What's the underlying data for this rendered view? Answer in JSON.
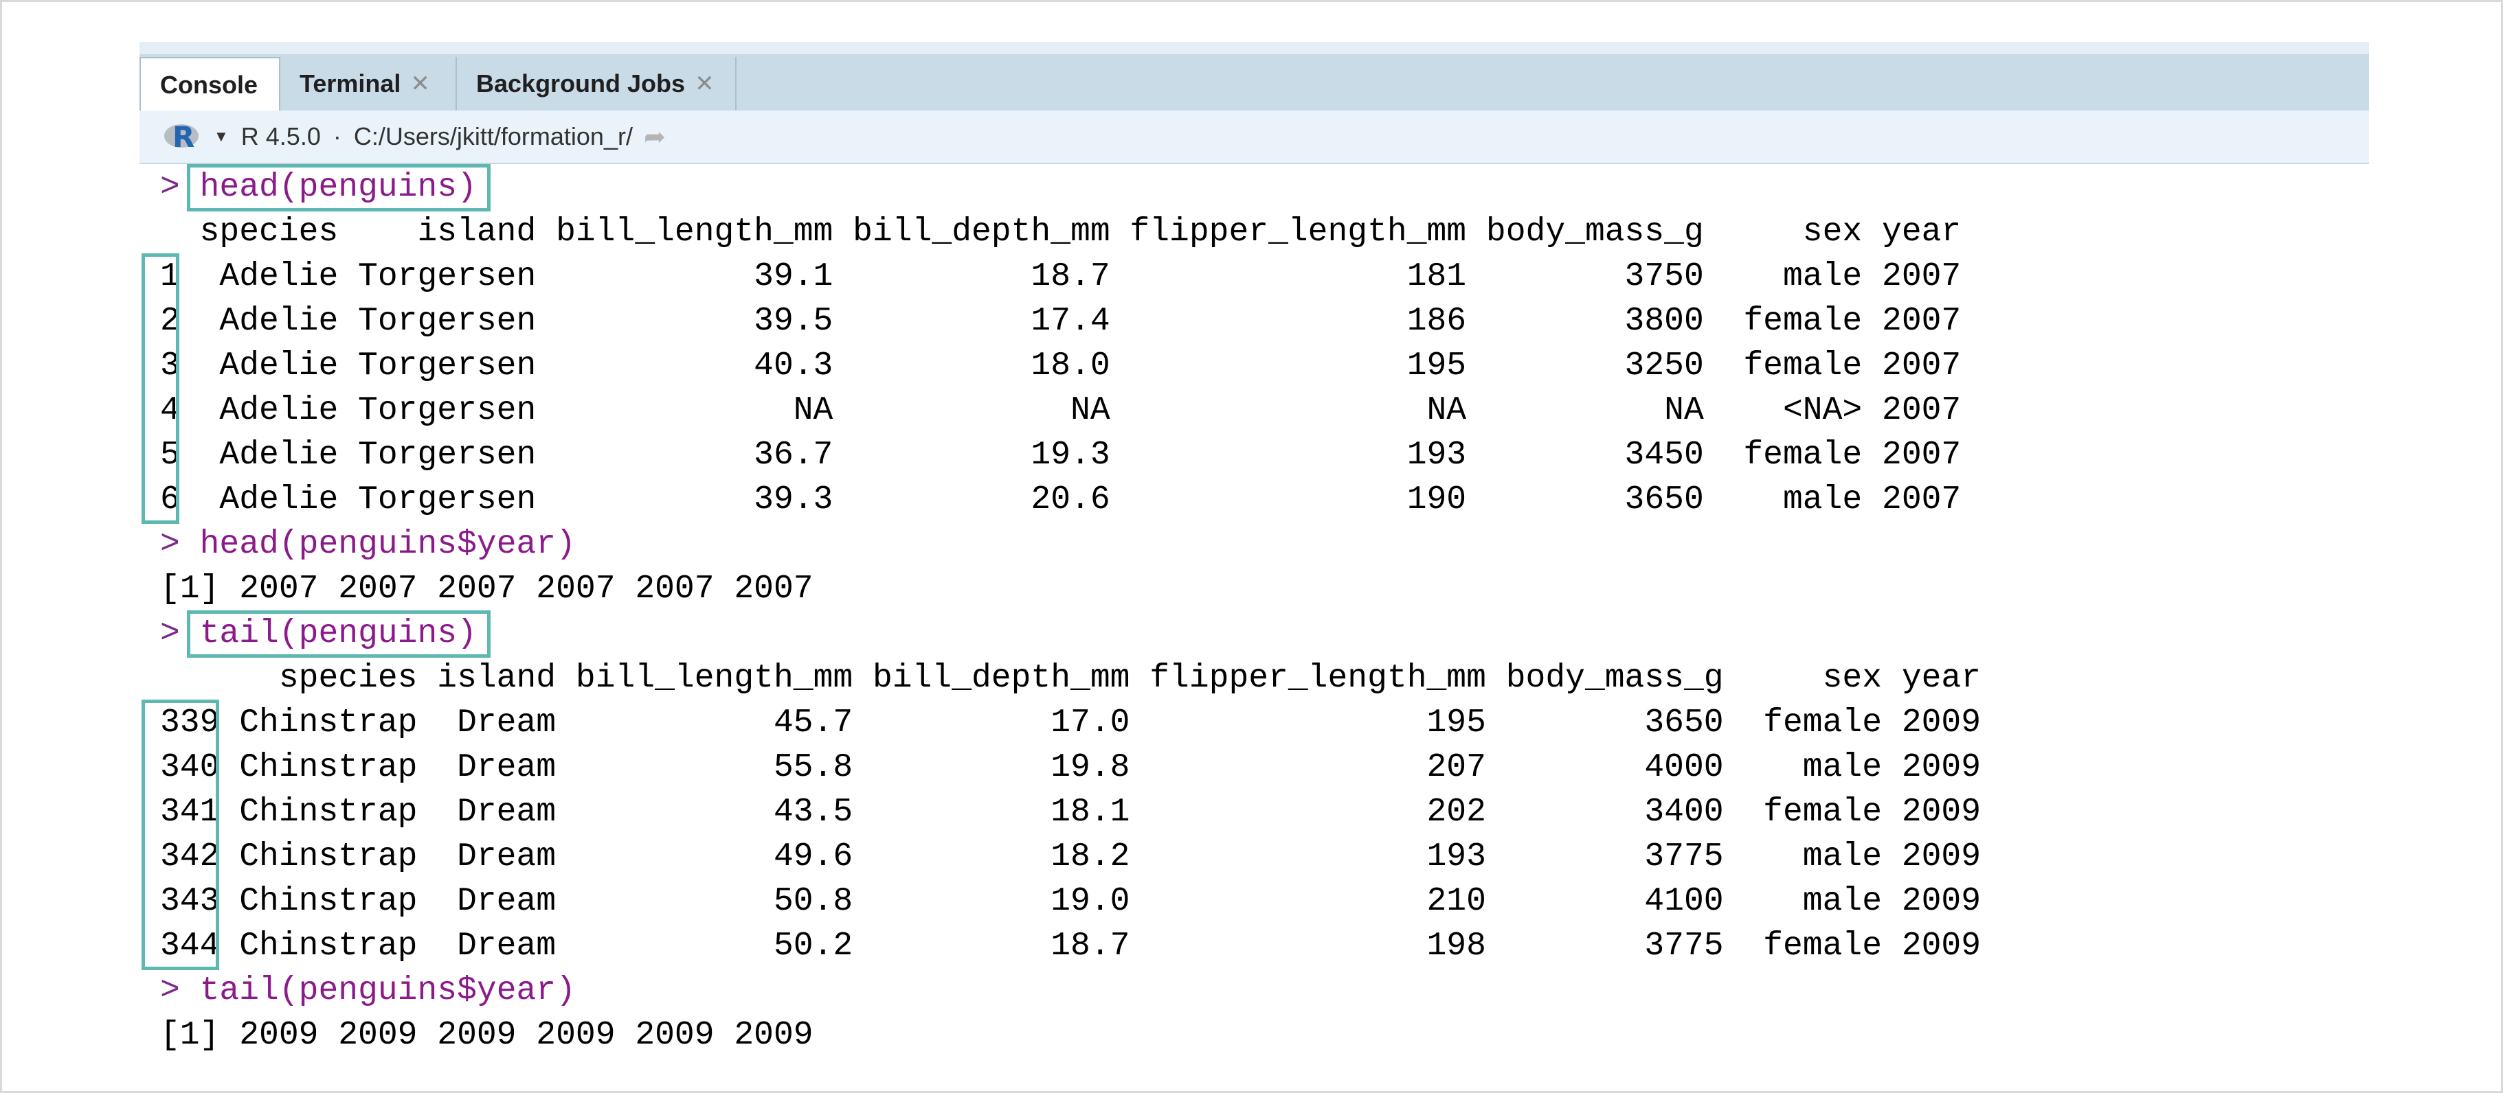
{
  "tabs": [
    {
      "label": "Console",
      "closable": false,
      "active": true
    },
    {
      "label": "Terminal",
      "closable": true,
      "active": false
    },
    {
      "label": "Background Jobs",
      "closable": true,
      "active": false
    }
  ],
  "toolbar": {
    "r_logo": "R",
    "version": "R 4.5.0",
    "separator": "·",
    "path": "C:/Users/jkitt/formation_r/",
    "nav_icon": "go-to-directory-icon"
  },
  "console": {
    "lines": [
      {
        "prompt": ">",
        "text": "head(penguins)",
        "type": "command"
      },
      {
        "text": "  species    island bill_length_mm bill_depth_mm flipper_length_mm body_mass_g     sex year",
        "type": "output"
      },
      {
        "text": "1  Adelie Torgersen           39.1          18.7               181        3750    male 2007",
        "type": "output"
      },
      {
        "text": "2  Adelie Torgersen           39.5          17.4               186        3800  female 2007",
        "type": "output"
      },
      {
        "text": "3  Adelie Torgersen           40.3          18.0               195        3250  female 2007",
        "type": "output"
      },
      {
        "text": "4  Adelie Torgersen             NA            NA                NA          NA    <NA> 2007",
        "type": "output"
      },
      {
        "text": "5  Adelie Torgersen           36.7          19.3               193        3450  female 2007",
        "type": "output"
      },
      {
        "text": "6  Adelie Torgersen           39.3          20.6               190        3650    male 2007",
        "type": "output"
      },
      {
        "prompt": ">",
        "text": "head(penguins$year)",
        "type": "command"
      },
      {
        "text": "[1] 2007 2007 2007 2007 2007 2007",
        "type": "output"
      },
      {
        "prompt": ">",
        "text": "tail(penguins)",
        "type": "command"
      },
      {
        "text": "      species island bill_length_mm bill_depth_mm flipper_length_mm body_mass_g     sex year",
        "type": "output"
      },
      {
        "text": "339 Chinstrap  Dream           45.7          17.0               195        3650  female 2009",
        "type": "output"
      },
      {
        "text": "340 Chinstrap  Dream           55.8          19.8               207        4000    male 2009",
        "type": "output"
      },
      {
        "text": "341 Chinstrap  Dream           43.5          18.1               202        3400  female 2009",
        "type": "output"
      },
      {
        "text": "342 Chinstrap  Dream           49.6          18.2               193        3775    male 2009",
        "type": "output"
      },
      {
        "text": "343 Chinstrap  Dream           50.8          19.0               210        4100    male 2009",
        "type": "output"
      },
      {
        "text": "344 Chinstrap  Dream           50.2          18.7               198        3775  female 2009",
        "type": "output"
      },
      {
        "prompt": ">",
        "text": "tail(penguins$year)",
        "type": "command"
      },
      {
        "text": "[1] 2009 2009 2009 2009 2009 2009",
        "type": "output"
      }
    ]
  },
  "colors": {
    "highlight": "#5cb8b0",
    "command": "#8b1a8b",
    "tab_bar": "#c9dbe7"
  }
}
